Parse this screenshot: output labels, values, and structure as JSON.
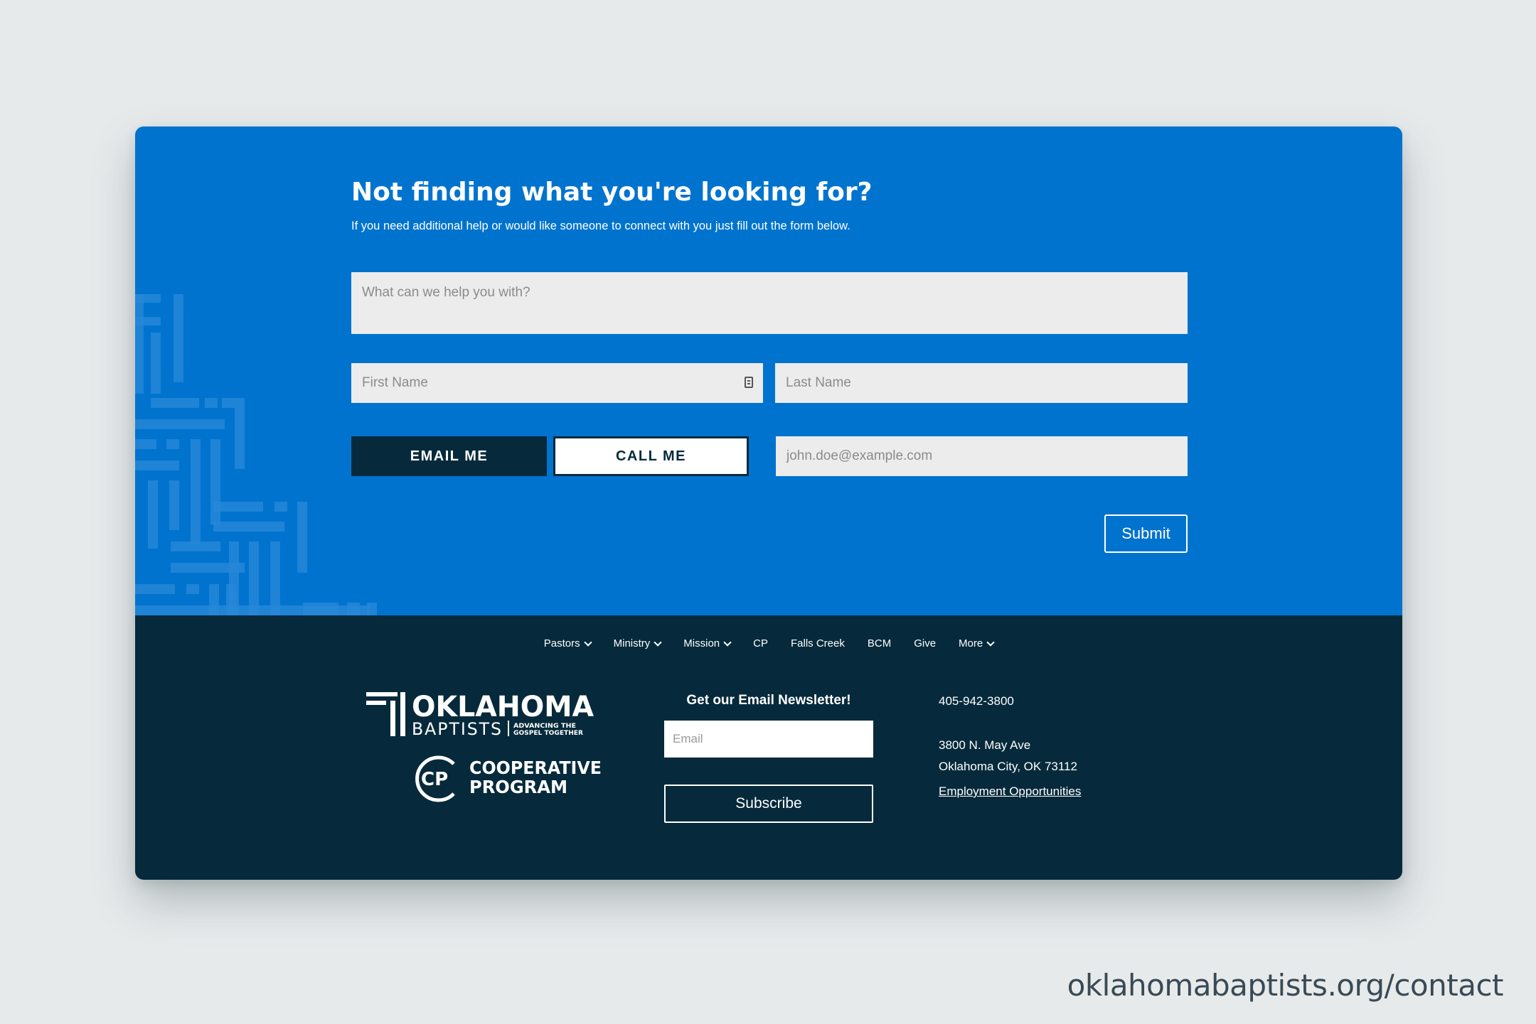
{
  "form": {
    "headline": "Not finding what you're looking for?",
    "subline": "If you need additional help or would like someone to connect with you just fill out the form below.",
    "help_placeholder": "What can we help you with?",
    "first_name_placeholder": "First Name",
    "last_name_placeholder": "Last Name",
    "email_me_label": "EMAIL ME",
    "call_me_label": "CALL ME",
    "email_placeholder": "john.doe@example.com",
    "submit_label": "Submit"
  },
  "nav": {
    "items": [
      {
        "label": "Pastors",
        "dropdown": true
      },
      {
        "label": "Ministry",
        "dropdown": true
      },
      {
        "label": "Mission",
        "dropdown": true
      },
      {
        "label": "CP",
        "dropdown": false
      },
      {
        "label": "Falls Creek",
        "dropdown": false
      },
      {
        "label": "BCM",
        "dropdown": false
      },
      {
        "label": "Give",
        "dropdown": false
      },
      {
        "label": "More",
        "dropdown": true
      }
    ]
  },
  "logos": {
    "oklahoma_word": "OKLAHOMA",
    "baptists_word": "BAPTISTS",
    "tagline_1": "ADVANCING THE",
    "tagline_2": "GOSPEL TOGETHER",
    "cp_mark": "CP",
    "cp_line_1": "COOPERATIVE",
    "cp_line_2": "PROGRAM"
  },
  "newsletter": {
    "title": "Get our Email Newsletter!",
    "email_placeholder": "Email",
    "subscribe_label": "Subscribe"
  },
  "contact": {
    "phone": "405-942-3800",
    "address_line_1": "3800 N. May Ave",
    "address_line_2": "Oklahoma City, OK 73112",
    "employment_link": "Employment Opportunities"
  },
  "caption": "oklahomabaptists.org/contact",
  "colors": {
    "hero_blue": "#0073cf",
    "navy": "#062a3b",
    "background": "#e7eaeb"
  }
}
